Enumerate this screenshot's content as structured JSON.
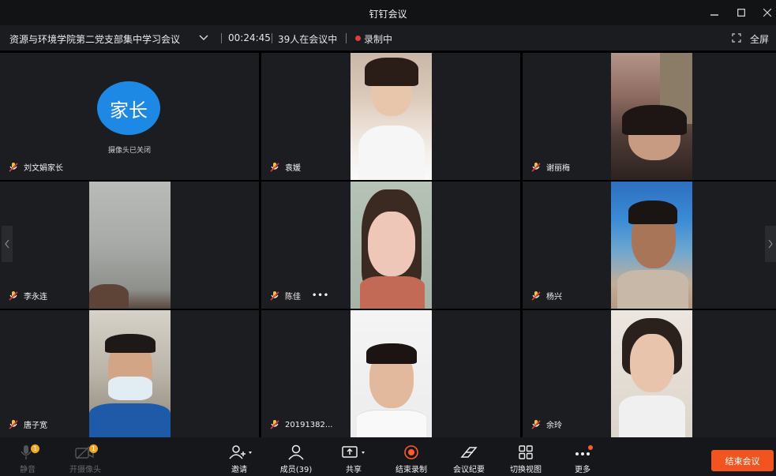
{
  "window": {
    "title": "钉钉会议"
  },
  "info": {
    "meeting_name": "资源与环境学院第二党支部集中学习会议",
    "timer": "00:24:45",
    "count": "39人在会议中",
    "recording": "录制中",
    "fullscreen": "全屏"
  },
  "tiles": [
    {
      "name": "刘文娟家长",
      "avatar_text": "家长",
      "camera_status": "摄像头已关闭"
    },
    {
      "name": "袁媛"
    },
    {
      "name": "谢丽梅"
    },
    {
      "name": "李永连"
    },
    {
      "name": "陈佳",
      "more": "•••"
    },
    {
      "name": "杨兴"
    },
    {
      "name": "唐子宽"
    },
    {
      "name": "20191382..."
    },
    {
      "name": "余玲"
    }
  ],
  "toolbar": {
    "mute": "静音",
    "camera": "开摄像头",
    "invite": "邀请",
    "members": "成员(39)",
    "share": "共享",
    "stop_record": "结束录制",
    "minutes": "会议纪要",
    "switch_view": "切换视图",
    "more": "更多",
    "end_meeting": "结束会议",
    "mute_badge": "1",
    "camera_badge": "1"
  },
  "colors": {
    "end_button": "#f2541f",
    "avatar": "#1e88e5",
    "record_dot": "#e23b3b",
    "badge": "#f5a623"
  }
}
